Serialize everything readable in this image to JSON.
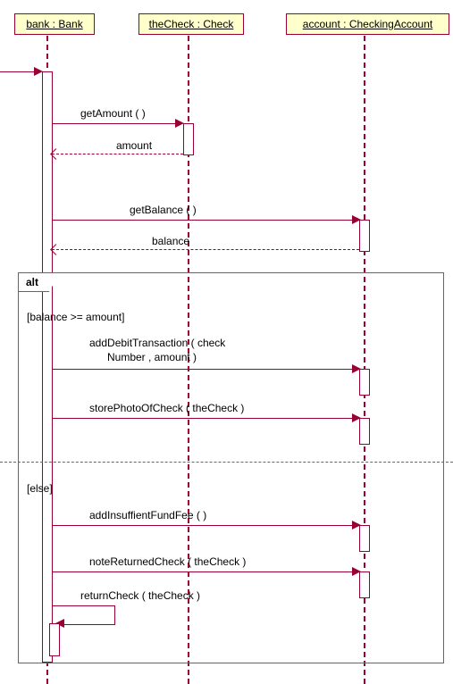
{
  "participants": {
    "bank": "bank : Bank",
    "theCheck": "theCheck : Check",
    "account": "account : CheckingAccount"
  },
  "messages": {
    "getAmount": "getAmount (  )",
    "amount": "amount",
    "getBalance": "getBalance (  )",
    "balance": "balance",
    "addDebit": "addDebitTransaction ( check",
    "addDebit2": "Number , amount )",
    "storePhoto": "storePhotoOfCheck ( theCheck )",
    "addInsuff": "addInsuffientFundFee (  )",
    "noteReturned": "noteReturnedCheck ( theCheck )",
    "returnCheck": "returnCheck ( theCheck )"
  },
  "frame": {
    "alt": "alt",
    "guard1": "[balance >= amount]",
    "guard2": "[else]"
  },
  "chart_data": {
    "type": "sequence_diagram",
    "participants": [
      {
        "id": "bank",
        "label": "bank : Bank"
      },
      {
        "id": "theCheck",
        "label": "theCheck : Check"
      },
      {
        "id": "account",
        "label": "account : CheckingAccount"
      }
    ],
    "messages": [
      {
        "from": "external",
        "to": "bank",
        "kind": "found",
        "label": ""
      },
      {
        "from": "bank",
        "to": "theCheck",
        "kind": "sync",
        "label": "getAmount()"
      },
      {
        "from": "theCheck",
        "to": "bank",
        "kind": "return",
        "label": "amount"
      },
      {
        "from": "bank",
        "to": "account",
        "kind": "sync",
        "label": "getBalance()"
      },
      {
        "from": "account",
        "to": "bank",
        "kind": "return",
        "label": "balance"
      }
    ],
    "fragments": [
      {
        "type": "alt",
        "operands": [
          {
            "guard": "balance >= amount",
            "messages": [
              {
                "from": "bank",
                "to": "account",
                "kind": "sync",
                "label": "addDebitTransaction(checkNumber, amount)"
              },
              {
                "from": "bank",
                "to": "account",
                "kind": "sync",
                "label": "storePhotoOfCheck(theCheck)"
              }
            ]
          },
          {
            "guard": "else",
            "messages": [
              {
                "from": "bank",
                "to": "account",
                "kind": "sync",
                "label": "addInsuffientFundFee()"
              },
              {
                "from": "bank",
                "to": "account",
                "kind": "sync",
                "label": "noteReturnedCheck(theCheck)"
              },
              {
                "from": "bank",
                "to": "bank",
                "kind": "self",
                "label": "returnCheck(theCheck)"
              }
            ]
          }
        ]
      }
    ]
  }
}
